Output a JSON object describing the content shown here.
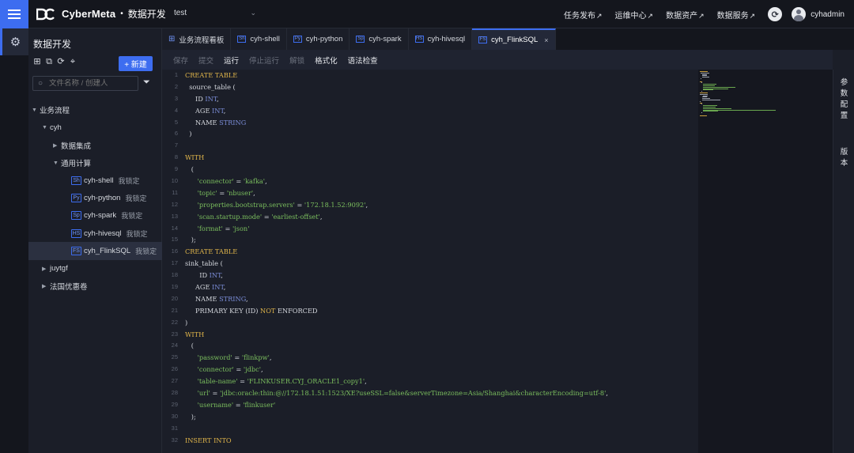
{
  "header": {
    "brand": "CyberMeta",
    "dot": "•",
    "module": "数据开发",
    "project": "test",
    "nav": [
      "任务发布",
      "运维中心",
      "数据资产",
      "数据服务"
    ],
    "ext_glyph": "↗",
    "user": "cyhadmin"
  },
  "sidebar": {
    "title": "数据开发",
    "new_button": "+ 新建",
    "search_placeholder": "文件名称 / 创建人",
    "tree": {
      "business_flow": "业务流程",
      "cyh": "cyh",
      "data_integration": "数据集成",
      "general_compute": "通用计算",
      "files": [
        {
          "type": "Sh",
          "name": "cyh-shell",
          "lock": "我锁定"
        },
        {
          "type": "Py",
          "name": "cyh-python",
          "lock": "我锁定"
        },
        {
          "type": "Sp",
          "name": "cyh-spark",
          "lock": "我锁定"
        },
        {
          "type": "HS",
          "name": "cyh-hivesql",
          "lock": "我锁定"
        },
        {
          "type": "FS",
          "name": "cyh_FlinkSQL",
          "lock": "我锁定"
        }
      ],
      "juytgf": "juytgf",
      "coupon": "法国优惠卷"
    }
  },
  "tabs": [
    {
      "icon": "",
      "label": "业务流程看板"
    },
    {
      "icon": "Sh",
      "label": "cyh-shell"
    },
    {
      "icon": "Py",
      "label": "cyh-python"
    },
    {
      "icon": "Sp",
      "label": "cyh-spark"
    },
    {
      "icon": "HS",
      "label": "cyh-hivesql"
    },
    {
      "icon": "FS",
      "label": "cyh_FlinkSQL",
      "close": "×"
    }
  ],
  "toolbar": {
    "save": "保存",
    "submit": "提交",
    "run": "运行",
    "stop": "停止运行",
    "unlock": "解锁",
    "format": "格式化",
    "syntax": "语法检查"
  },
  "editor": {
    "lines": [
      "CREATE TABLE",
      "  source_table (",
      "     ID INT,",
      "     AGE INT,",
      "     NAME STRING",
      "  )",
      "",
      "WITH",
      "   (",
      "      'connector' = 'kafka',",
      "      'topic' = 'nbuser',",
      "      'properties.bootstrap.servers' = '172.18.1.52:9092',",
      "      'scan.startup.mode' = 'earliest-offset',",
      "      'format' = 'json'",
      "   );",
      "CREATE TABLE",
      "sink_table (",
      "       ID INT,",
      "     AGE INT,",
      "     NAME STRING,",
      "     PRIMARY KEY (ID) NOT ENFORCED",
      ")",
      "WITH",
      "   (",
      "      'password' = 'flinkpw',",
      "      'connector' = 'jdbc',",
      "      'table-name' = 'FLINKUSER.CYJ_ORACLE1_copy1',",
      "      'url' = 'jdbc:oracle:thin:@//172.18.1.51:1523/XE?useSSL=false&serverTimezone=Asia/Shanghai&characterEncoding=utf-8',",
      "      'username' = 'flinkuser'",
      "   );",
      "",
      "INSERT INTO"
    ]
  },
  "right_rail": {
    "params": [
      "参",
      "数",
      "配",
      "置"
    ],
    "version": [
      "版",
      "本"
    ]
  }
}
